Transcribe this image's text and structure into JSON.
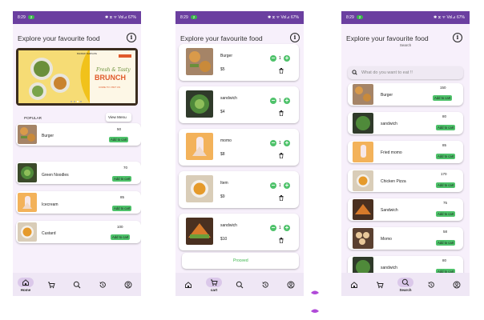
{
  "colors": {
    "primary": "#6b3fa0",
    "green": "#4ec26a",
    "bg": "#f7f0fb",
    "nav": "#efe7f5"
  },
  "status": {
    "time": "8:29",
    "badge": "2",
    "right": "✱ ⧖ ᯤ Vol⊿ 67%"
  },
  "screens": {
    "home": {
      "title": "Explore your favourite food",
      "info_icon": "i",
      "banner": {
        "kicker": "BANNER TEMPLATE",
        "line1": "Fresh & Tasty",
        "line2": "BRUNCH",
        "cta": "COME TO VISIT US"
      },
      "popular_label": "POPULAR",
      "view_menu": "View Menu",
      "items": [
        {
          "name": "Burger",
          "count": "50",
          "cta": "Add to cart",
          "icon": "burger-image"
        },
        {
          "name": "Green Noodles",
          "count": "70",
          "cta": "Add to cart",
          "icon": "noodles-image"
        },
        {
          "name": "Icecream",
          "count": "85",
          "cta": "Add to cart",
          "icon": "icecream-image"
        },
        {
          "name": "Custard",
          "count": "100",
          "cta": "Add to cart",
          "icon": "custard-image"
        }
      ],
      "nav_label": "Home"
    },
    "cart": {
      "title": "Explore your favourite food",
      "items": [
        {
          "name": "Burger",
          "price": "$5",
          "qty": "1"
        },
        {
          "name": "sandwich",
          "price": "$4",
          "qty": "1"
        },
        {
          "name": "momo",
          "price": "$8",
          "qty": "1"
        },
        {
          "name": "Item",
          "price": "$9",
          "qty": "1"
        },
        {
          "name": "sandwich",
          "price": "$10",
          "qty": "1"
        }
      ],
      "proceed": "Proceed",
      "nav_label": "cart"
    },
    "search": {
      "title": "Explore your favourite food",
      "subtitle": "Search",
      "placeholder": "What do you want to eat !!",
      "items": [
        {
          "name": "Burger",
          "count": "150",
          "cta": "Add to cart"
        },
        {
          "name": "sandwich",
          "count": "80",
          "cta": "Add to cart"
        },
        {
          "name": "Fried momo",
          "count": "85",
          "cta": "Add to cart"
        },
        {
          "name": "Chicken Pizza",
          "count": "170",
          "cta": "Add to cart"
        },
        {
          "name": "Sandwich",
          "count": "75",
          "cta": "Add to cart"
        },
        {
          "name": "Momo",
          "count": "58",
          "cta": "Add to cart"
        },
        {
          "name": "sandwich",
          "count": "80",
          "cta": "Add to cart"
        }
      ],
      "nav_label": "Search"
    }
  }
}
